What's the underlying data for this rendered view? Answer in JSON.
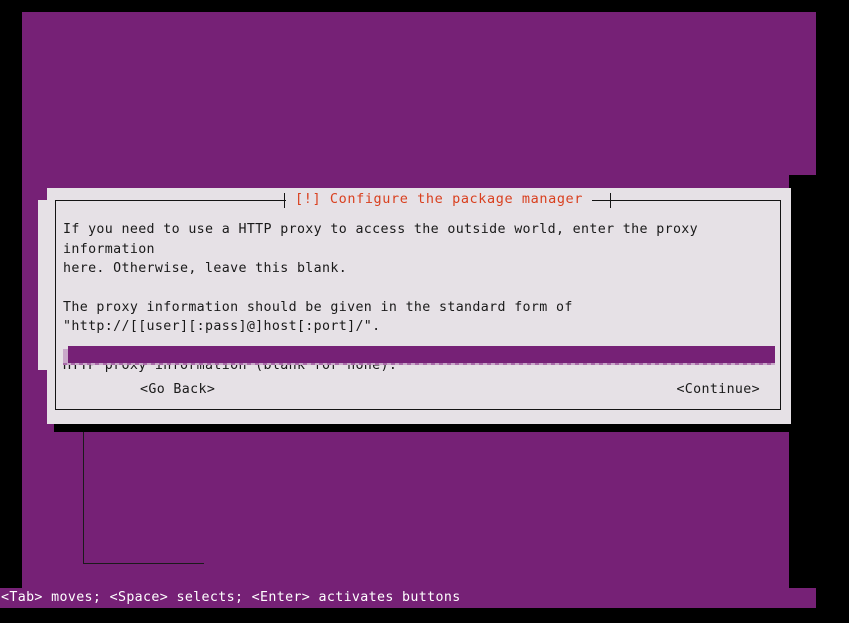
{
  "theme": {
    "terminal_bg": "#762176",
    "dialog_bg": "#e6e1e6",
    "dialog_border": "#141414",
    "title_color": "#d9401f",
    "text_color": "#1a1a1a",
    "input_bg": "#762176",
    "status_bar_bg": "#762176",
    "status_bar_text": "#ffffff",
    "shadow": "#000000"
  },
  "dialog": {
    "title": "[!] Configure the package manager",
    "paragraphs": [
      "If you need to use a HTTP proxy to access the outside world, enter the proxy information\nhere. Otherwise, leave this blank.",
      "The proxy information should be given in the standard form of\n\"http://[[user][:pass]@]host[:port]/\"."
    ],
    "field_label": "HTTP proxy information (blank for none):",
    "input": {
      "value": "",
      "placeholder": ""
    },
    "buttons": {
      "back": "<Go Back>",
      "continue": "<Continue>"
    }
  },
  "status_bar": {
    "text": "<Tab> moves; <Space> selects; <Enter> activates buttons"
  }
}
